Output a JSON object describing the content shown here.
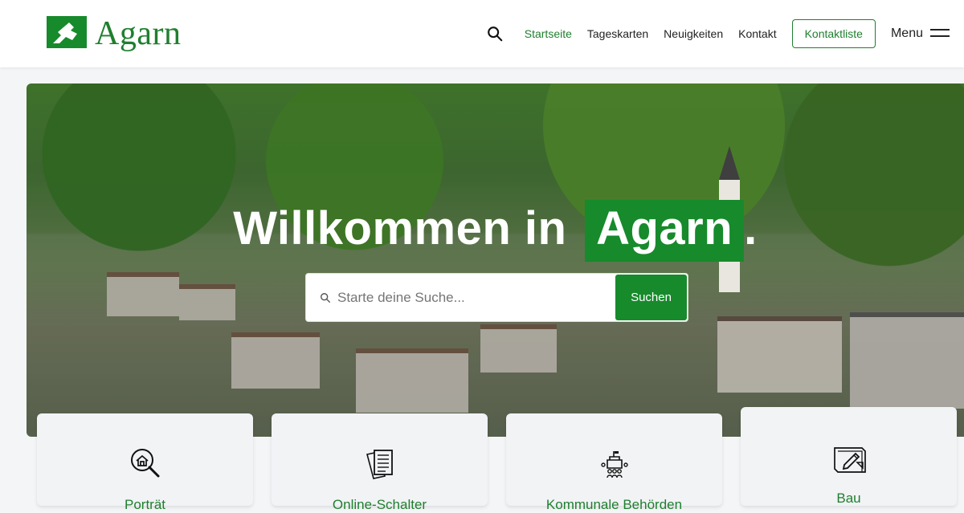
{
  "brand": {
    "name": "Agarn"
  },
  "header": {
    "search_icon": "search-icon",
    "nav": [
      {
        "label": "Startseite",
        "active": true
      },
      {
        "label": "Tageskarten",
        "active": false
      },
      {
        "label": "Neuigkeiten",
        "active": false
      },
      {
        "label": "Kontakt",
        "active": false
      }
    ],
    "contact_list": "Kontaktliste",
    "menu": "Menu"
  },
  "hero": {
    "title_prefix": "Willkommen in",
    "title_highlight": "Agarn",
    "title_suffix": ".",
    "search": {
      "placeholder": "Starte deine Suche...",
      "button": "Suchen"
    }
  },
  "cards": [
    {
      "label": "Porträt",
      "icon": "house-search-icon"
    },
    {
      "label": "Online-Schalter",
      "icon": "documents-icon"
    },
    {
      "label": "Kommunale Behörden",
      "icon": "town-hall-people-icon"
    },
    {
      "label": "Bau",
      "icon": "blueprint-pencil-icon"
    }
  ],
  "colors": {
    "brand_green": "#178a2c",
    "text_green": "#1f7f2f"
  }
}
